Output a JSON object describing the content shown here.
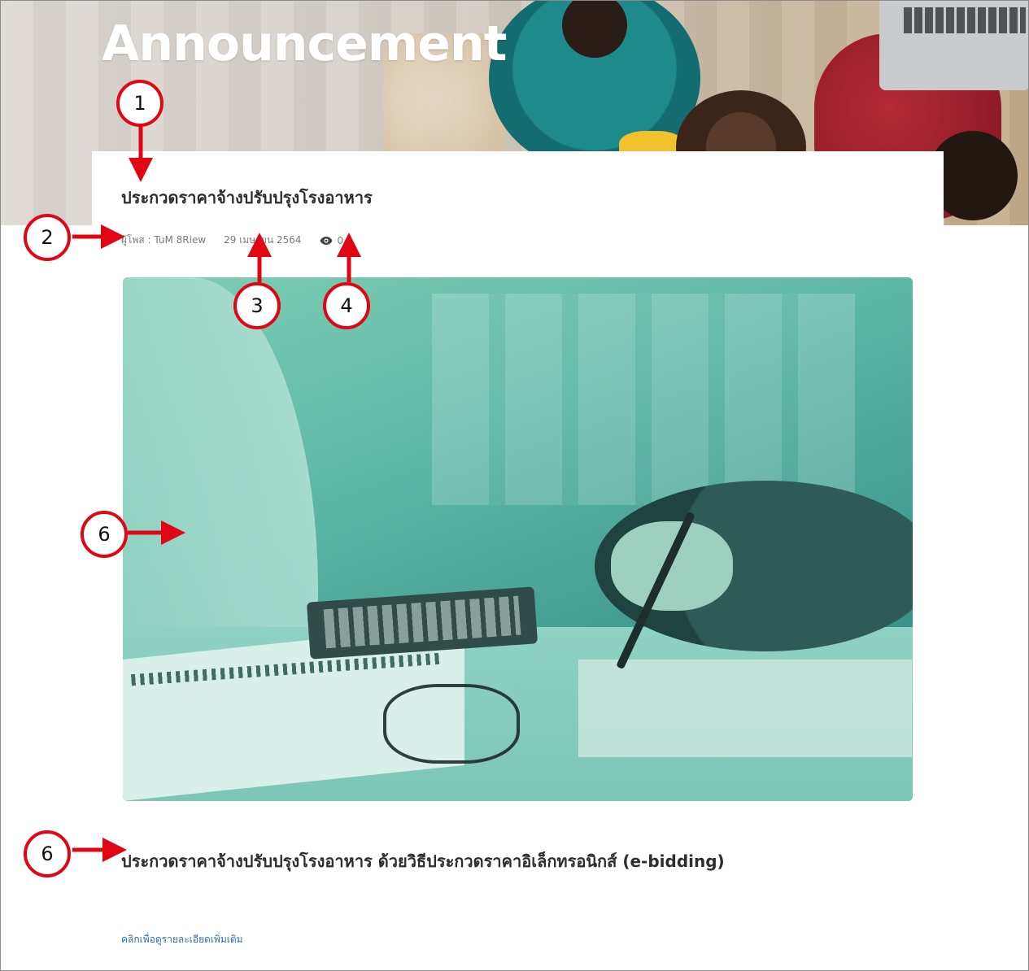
{
  "hero": {
    "title": "Announcement"
  },
  "post": {
    "title": "ประกวดราคาจ้างปรับปรุงโรงอาหาร",
    "author": "ผู้โพส : TuM 8Riew",
    "date": "29 เมษายน 2564",
    "views": "0",
    "excerpt": "ประกวดราคาจ้างปรับปรุงโรงอาหาร ด้วยวิธีประกวดราคาอิเล็กทรอนิกส์ (e-bidding)",
    "more_link": "คลิกเพื่อดูรายละเอียดเพิ่มเติม"
  },
  "annotations": {
    "c1": "1",
    "c2": "2",
    "c3": "3",
    "c4": "4",
    "c6a": "6",
    "c6b": "6"
  },
  "colors": {
    "annotation_red": "#e10613",
    "link_blue": "#2f6db5",
    "image_tint": "#4fae9c"
  },
  "icons": {
    "views": "eye-icon"
  }
}
